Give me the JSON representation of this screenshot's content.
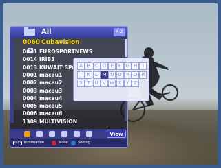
{
  "panel": {
    "title": "All",
    "sort_button": "A-Z",
    "selected_channel": {
      "number": "0060",
      "name": "Cubavision"
    },
    "channels": [
      {
        "number": "0001",
        "name": "EUROSPORTNEWS",
        "icon": "$"
      },
      {
        "number": "0014",
        "name": "IRIB3"
      },
      {
        "number": "0013",
        "name": "KUWAIT SPACE CHANN"
      },
      {
        "number": "0001",
        "name": "macau1"
      },
      {
        "number": "0002",
        "name": "macau2"
      },
      {
        "number": "0003",
        "name": "macau3"
      },
      {
        "number": "0004",
        "name": "macau4"
      },
      {
        "number": "0005",
        "name": "macau5"
      },
      {
        "number": "0006",
        "name": "macau6"
      },
      {
        "number": "1309",
        "name": "MULTIVISION"
      }
    ]
  },
  "toolbar": {
    "icons": [
      "tv-folder-icon",
      "trash-icon",
      "move-icon",
      "edit-icon",
      "lock-icon",
      "rename-icon"
    ],
    "view_label": "View"
  },
  "info_bar": {
    "info_badge": "Info",
    "info_label": "Information",
    "mode_label": "Mode",
    "sorting_label": "Sorting",
    "colors": {
      "red": "#d8232a",
      "blue": "#2a7fd8"
    }
  },
  "alphabet": {
    "rows": [
      [
        "A",
        "B",
        "C",
        "D",
        "E",
        "F",
        "G",
        "H",
        "I"
      ],
      [
        "J",
        "K",
        "L",
        "M",
        "N",
        "O",
        "P",
        "Q",
        "R"
      ],
      [
        "S",
        "T",
        "U",
        "V",
        "W",
        "X",
        "Y",
        "Z"
      ]
    ],
    "selected": "M"
  }
}
